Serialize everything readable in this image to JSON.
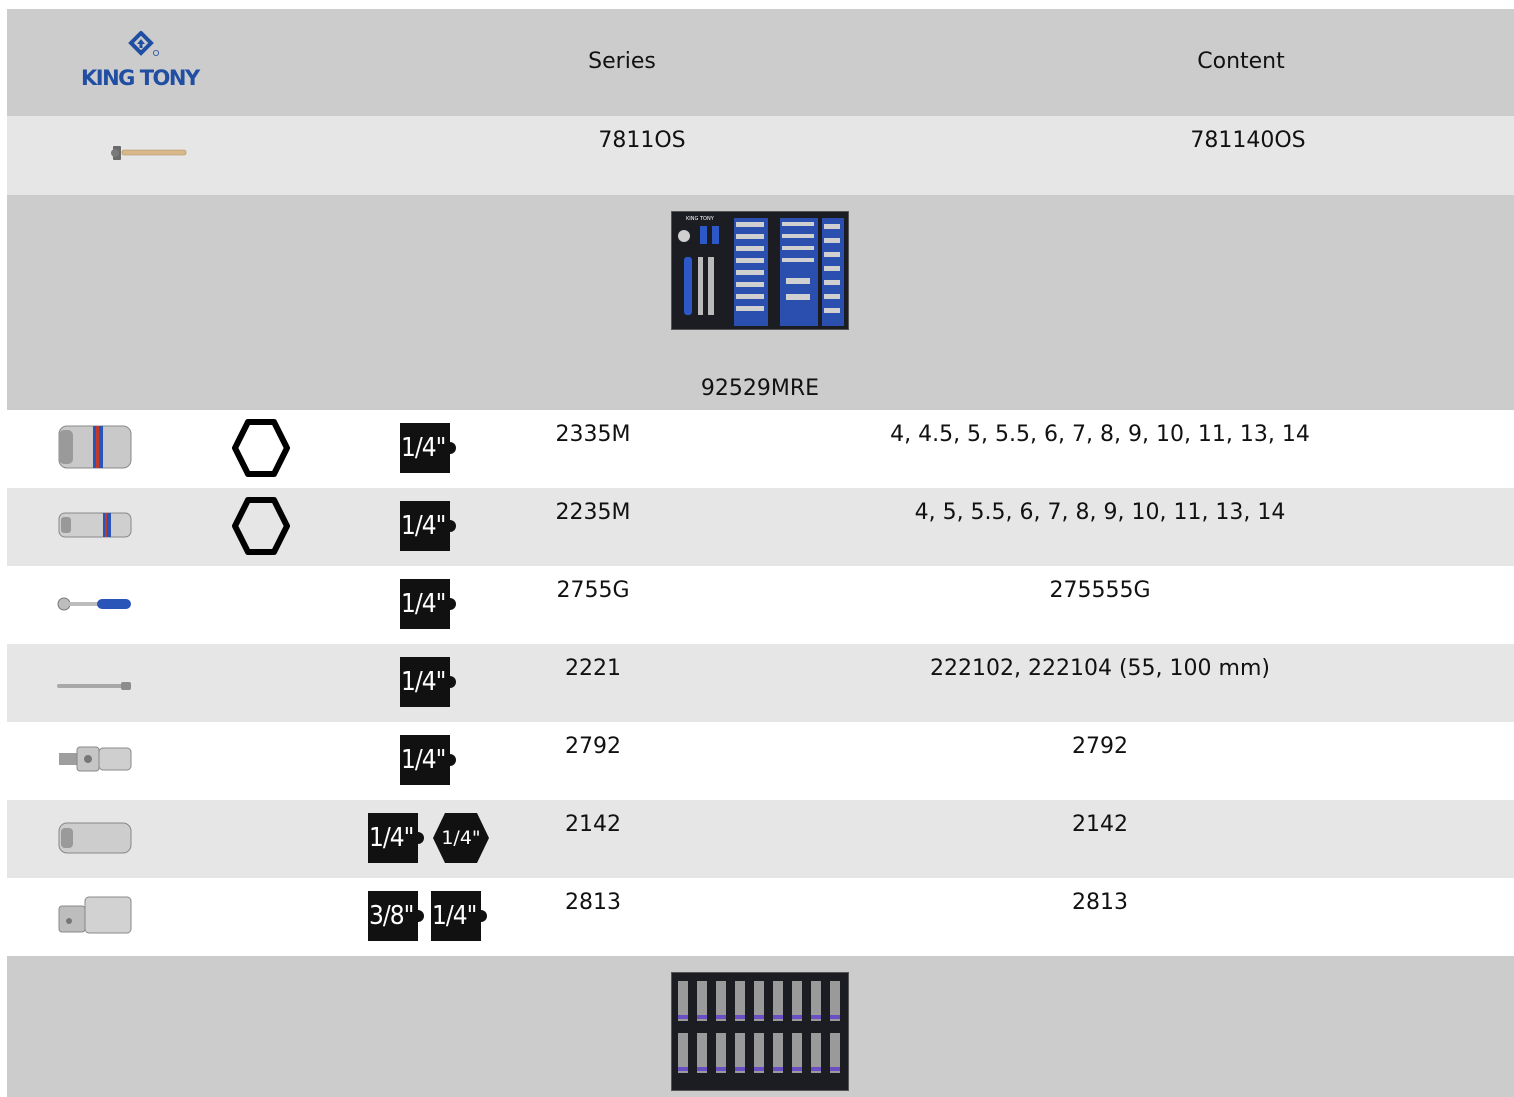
{
  "header": {
    "brand": "KING TONY",
    "series_label": "Series",
    "content_label": "Content"
  },
  "hammer_row": {
    "series": "7811OS",
    "content": "781140OS"
  },
  "section1": {
    "title": "92529MRE",
    "tray_brand": "KING TONY"
  },
  "rows": [
    {
      "series": "2335M",
      "content": "4, 4.5, 5, 5.5, 6, 7, 8, 9, 10, 11, 13, 14",
      "drive": "1/4\"",
      "hex_profile": true,
      "tool_icon": "socket-icon"
    },
    {
      "series": "2235M",
      "content": "4, 5, 5.5, 6, 7, 8, 9, 10, 11, 13, 14",
      "drive": "1/4\"",
      "hex_profile": true,
      "tool_icon": "deep-socket-icon"
    },
    {
      "series": "2755G",
      "content": "275555G",
      "drive": "1/4\"",
      "hex_profile": false,
      "tool_icon": "ratchet-icon"
    },
    {
      "series": "2221",
      "content": "222102, 222104 (55, 100 mm)",
      "drive": "1/4\"",
      "hex_profile": false,
      "tool_icon": "extension-bar-icon"
    },
    {
      "series": "2792",
      "content": "2792",
      "drive": "1/4\"",
      "hex_profile": false,
      "tool_icon": "universal-joint-icon"
    },
    {
      "series": "2142",
      "content": "2142",
      "drive": "1/4\"",
      "drive2": "1/4\"",
      "hex_profile": false,
      "tool_icon": "bit-adaptor-icon"
    },
    {
      "series": "2813",
      "content": "2813",
      "drive": "3/8\"",
      "drive2": "1/4\"",
      "hex_profile": false,
      "tool_icon": "adaptor-icon"
    }
  ],
  "colors": {
    "header_bg": "#cccccc",
    "row_alt_bg": "#e6e6e6",
    "brand_blue": "#1f4ea3"
  }
}
